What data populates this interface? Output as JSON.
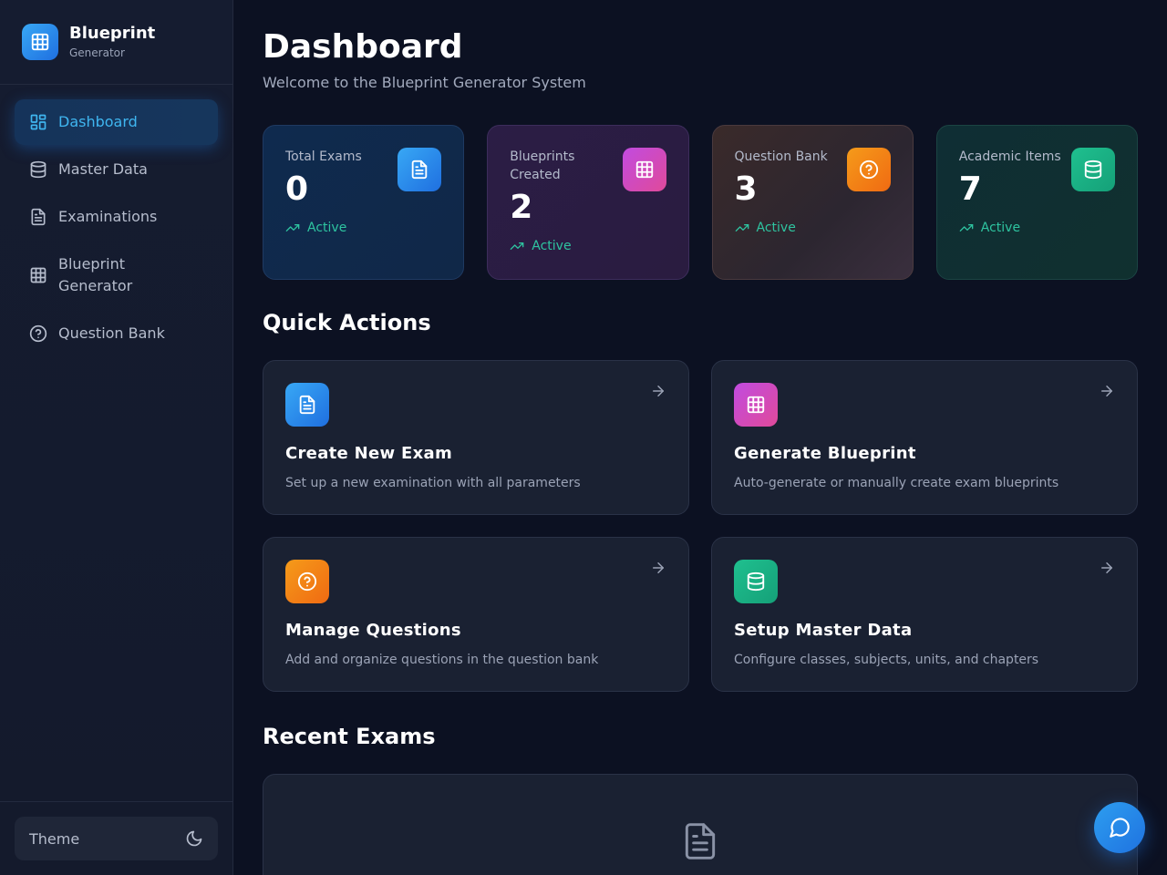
{
  "brand": {
    "title": "Blueprint",
    "subtitle": "Generator"
  },
  "sidebar": {
    "items": [
      {
        "label": "Dashboard",
        "icon": "layout-dashboard-icon",
        "active": true
      },
      {
        "label": "Master Data",
        "icon": "database-icon"
      },
      {
        "label": "Examinations",
        "icon": "file-text-icon"
      },
      {
        "label": "Blueprint Generator",
        "icon": "grid-icon"
      },
      {
        "label": "Question Bank",
        "icon": "help-circle-icon"
      }
    ],
    "theme_label": "Theme",
    "theme_icon": "moon-icon"
  },
  "header": {
    "title": "Dashboard",
    "subtitle": "Welcome to the Blueprint Generator System"
  },
  "stats": [
    {
      "label": "Total Exams",
      "value": "0",
      "status": "Active",
      "icon": "file-text-icon",
      "color": "#1f6fe0"
    },
    {
      "label": "Blueprints Created",
      "value": "2",
      "status": "Active",
      "icon": "grid-icon",
      "color": "#c14be0"
    },
    {
      "label": "Question Bank",
      "value": "3",
      "status": "Active",
      "icon": "help-circle-icon",
      "color": "#f06a12"
    },
    {
      "label": "Academic Items",
      "value": "7",
      "status": "Active",
      "icon": "database-icon",
      "color": "#15a078"
    }
  ],
  "quick_actions": {
    "title": "Quick Actions",
    "items": [
      {
        "title": "Create New Exam",
        "description": "Set up a new examination with all parameters",
        "icon": "file-text-icon"
      },
      {
        "title": "Generate Blueprint",
        "description": "Auto-generate or manually create exam blueprints",
        "icon": "grid-icon"
      },
      {
        "title": "Manage Questions",
        "description": "Add and organize questions in the question bank",
        "icon": "help-circle-icon"
      },
      {
        "title": "Setup Master Data",
        "description": "Configure classes, subjects, units, and chapters",
        "icon": "database-icon"
      }
    ]
  },
  "recent_exams": {
    "title": "Recent Exams",
    "empty_icon": "file-text-icon"
  },
  "chat": {
    "icon": "message-circle-icon"
  },
  "colors": {
    "accent": "#3fb6f0",
    "status_green": "#2ec4a0",
    "background": "#0c1122"
  }
}
